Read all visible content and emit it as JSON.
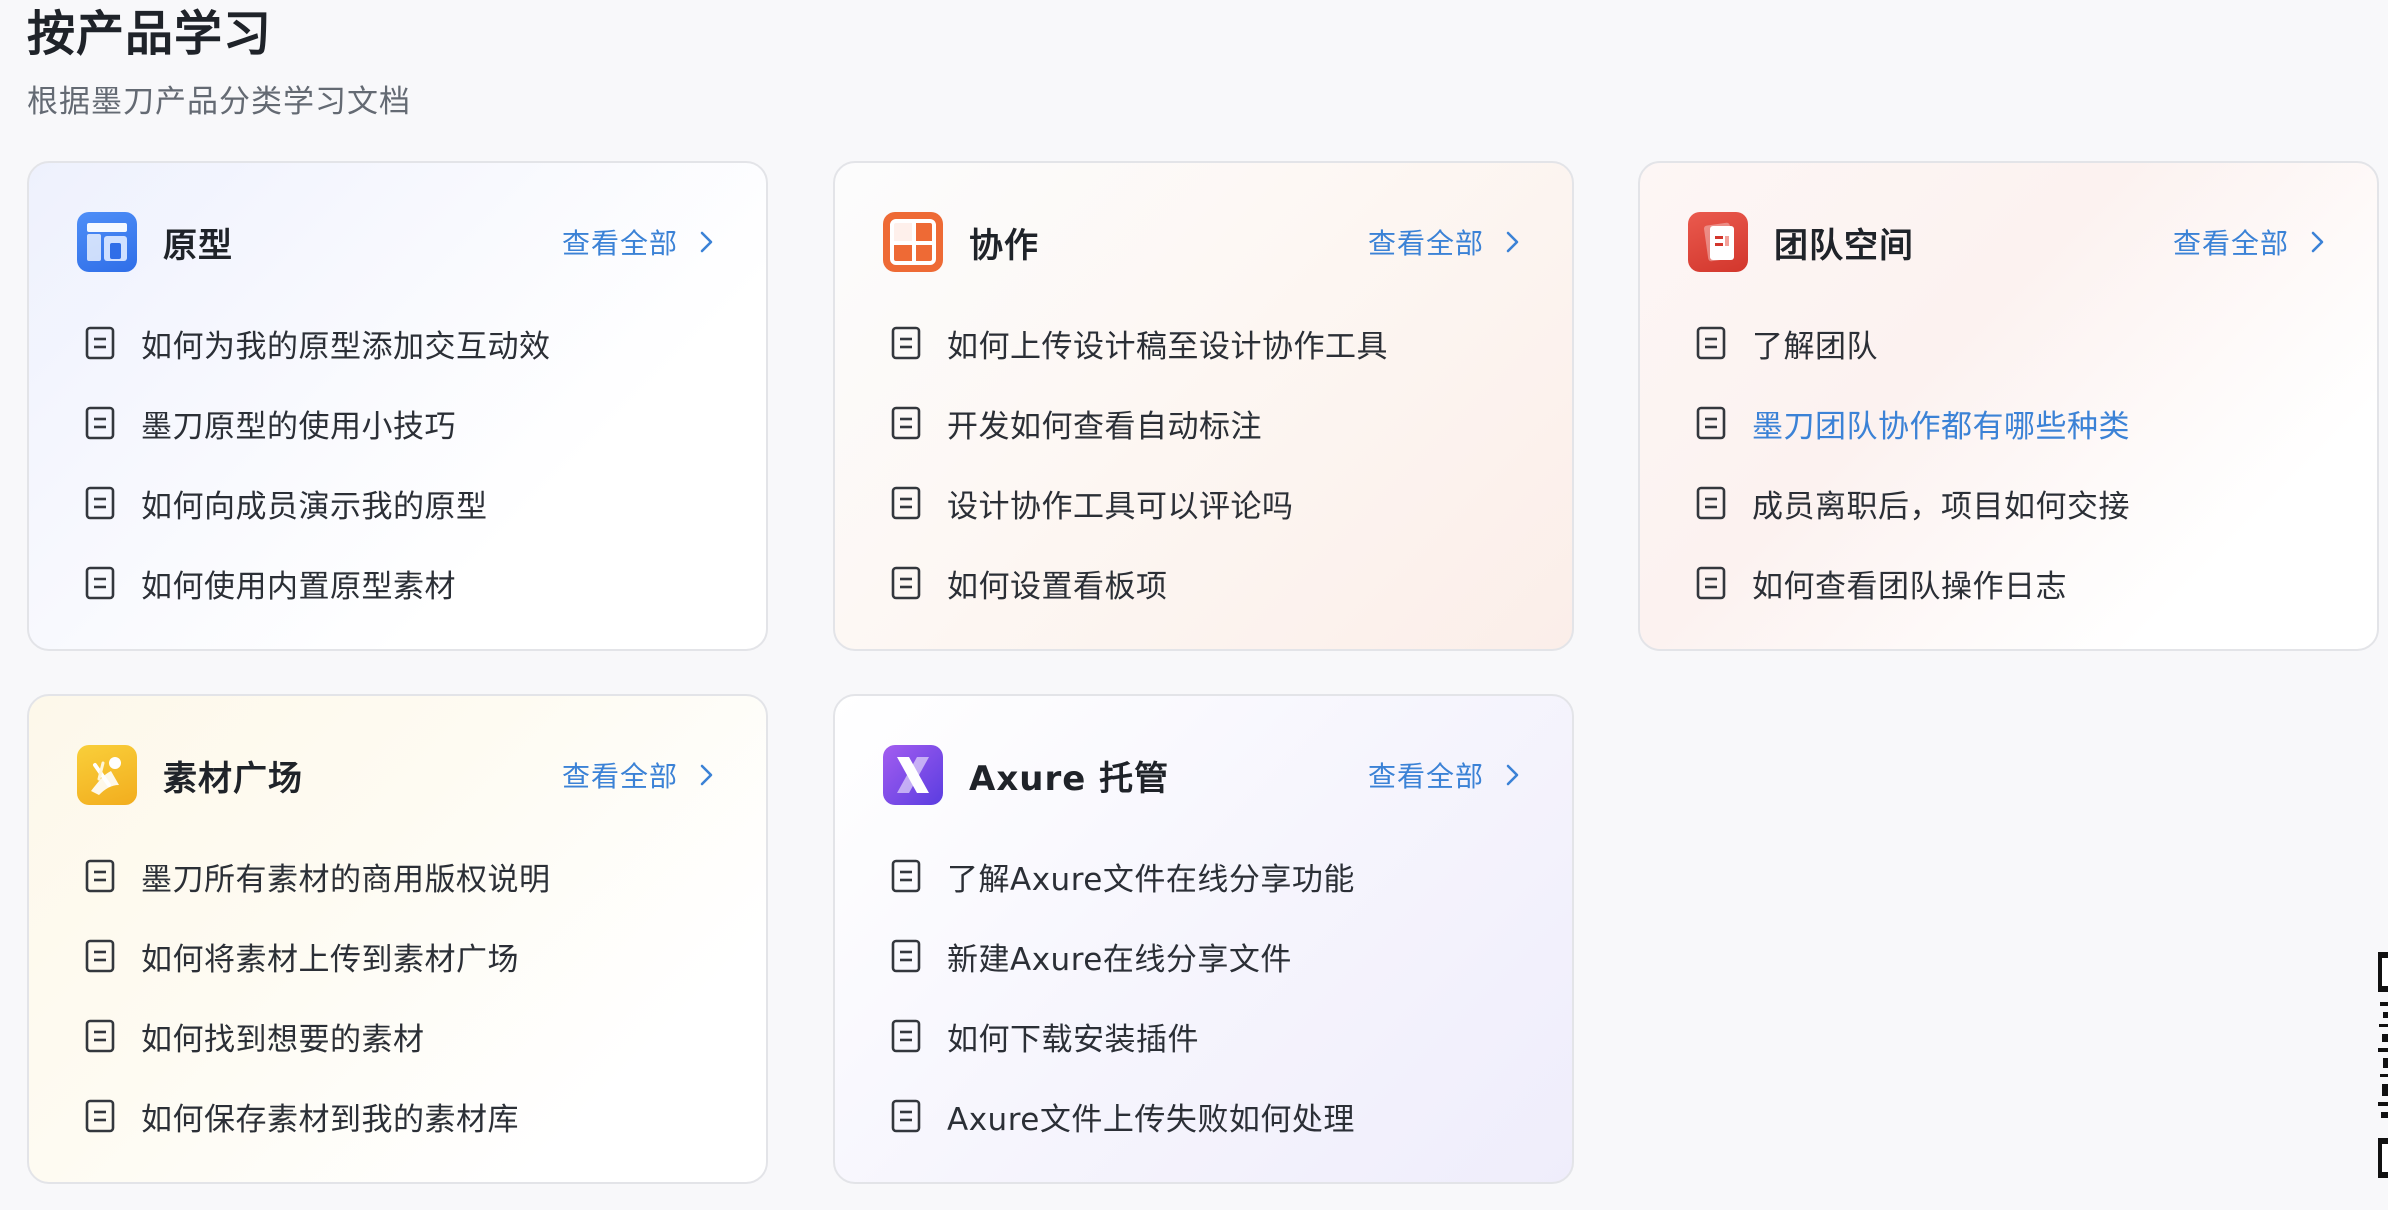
{
  "page": {
    "title": "按产品学习",
    "subtitle": "根据墨刀产品分类学习文档"
  },
  "colors": {
    "link": "#3b82d6",
    "prototype_icon": "#3f7cf1",
    "collab_icon": "#ee6a35",
    "team_icon": "#e1453b",
    "material_icon": "#f6bf2a",
    "axure_icon": "#7b4be6"
  },
  "cards": [
    {
      "title": "原型",
      "icon": "prototype-icon",
      "view_all": "查看全部",
      "items": [
        {
          "text": "如何为我的原型添加交互动效"
        },
        {
          "text": "墨刀原型的使用小技巧"
        },
        {
          "text": "如何向成员演示我的原型"
        },
        {
          "text": "如何使用内置原型素材"
        }
      ]
    },
    {
      "title": "协作",
      "icon": "collaboration-icon",
      "view_all": "查看全部",
      "items": [
        {
          "text": "如何上传设计稿至设计协作工具"
        },
        {
          "text": "开发如何查看自动标注"
        },
        {
          "text": "设计协作工具可以评论吗"
        },
        {
          "text": "如何设置看板项"
        }
      ]
    },
    {
      "title": "团队空间",
      "icon": "team-space-icon",
      "view_all": "查看全部",
      "items": [
        {
          "text": "了解团队"
        },
        {
          "text": "墨刀团队协作都有哪些种类",
          "state": "hover"
        },
        {
          "text": "成员离职后，项目如何交接"
        },
        {
          "text": "如何查看团队操作日志"
        }
      ]
    },
    {
      "title": "素材广场",
      "icon": "material-plaza-icon",
      "view_all": "查看全部",
      "items": [
        {
          "text": "墨刀所有素材的商用版权说明"
        },
        {
          "text": "如何将素材上传到素材广场"
        },
        {
          "text": "如何找到想要的素材"
        },
        {
          "text": "如何保存素材到我的素材库"
        }
      ]
    },
    {
      "title": "Axure 托管",
      "icon": "axure-icon",
      "view_all": "查看全部",
      "items": [
        {
          "text": "了解Axure文件在线分享功能"
        },
        {
          "text": "新建Axure在线分享文件"
        },
        {
          "text": "如何下载安装插件"
        },
        {
          "text": "Axure文件上传失败如何处理"
        }
      ]
    }
  ]
}
